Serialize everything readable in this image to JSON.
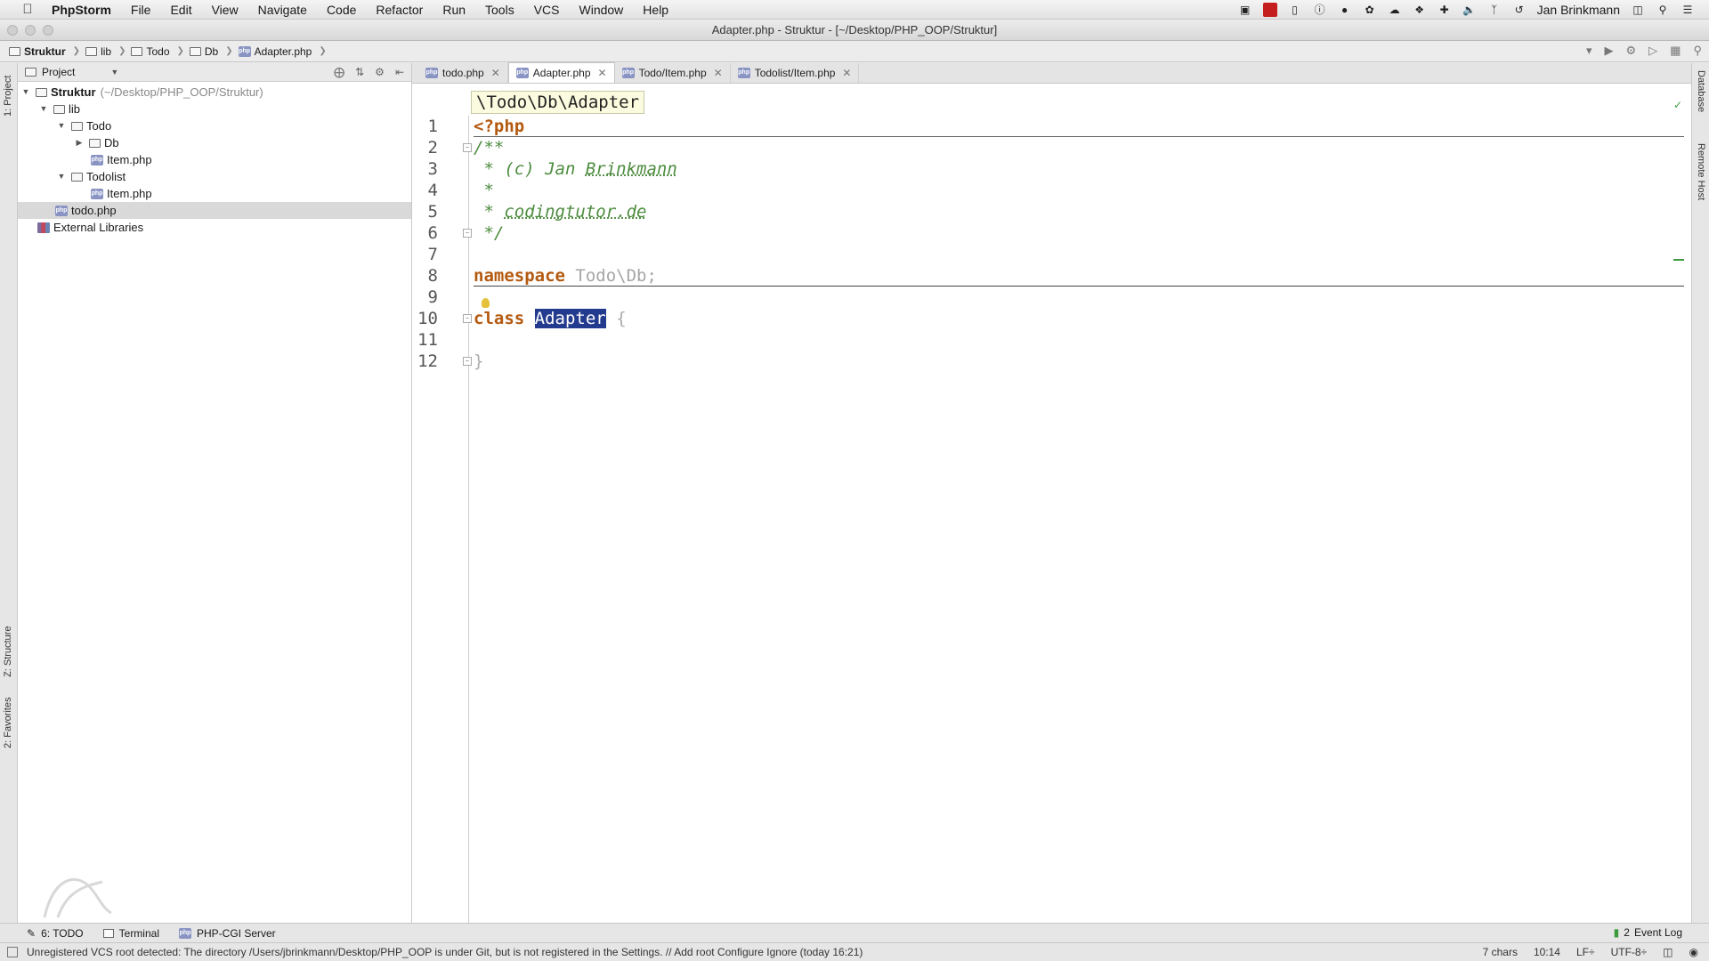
{
  "menubar": {
    "app": "PhpStorm",
    "items": [
      "File",
      "Edit",
      "View",
      "Navigate",
      "Code",
      "Refactor",
      "Run",
      "Tools",
      "VCS",
      "Window",
      "Help"
    ],
    "user": "Jan Brinkmann"
  },
  "window": {
    "title": "Adapter.php - Struktur - [~/Desktop/PHP_OOP/Struktur]"
  },
  "breadcrumb": [
    "Struktur",
    "lib",
    "Todo",
    "Db",
    "Adapter.php"
  ],
  "project_panel": {
    "title": "Project",
    "tree": [
      {
        "label": "Struktur",
        "hint": "(~/Desktop/PHP_OOP/Struktur)"
      },
      {
        "label": "lib"
      },
      {
        "label": "Todo"
      },
      {
        "label": "Db"
      },
      {
        "label": "Item.php"
      },
      {
        "label": "Todolist"
      },
      {
        "label": "Item.php"
      },
      {
        "label": "todo.php"
      },
      {
        "label": "External Libraries"
      }
    ]
  },
  "side_tabs": {
    "left_top": "1: Project",
    "left_mid": "Z: Structure",
    "left_bottom": "2: Favorites",
    "right_top": "Database",
    "right_mid": "Remote Host"
  },
  "tabs": [
    {
      "label": "todo.php"
    },
    {
      "label": "Adapter.php"
    },
    {
      "label": "Todo/Item.php"
    },
    {
      "label": "Todolist/Item.php"
    }
  ],
  "editor": {
    "namespace_badge": "\\Todo\\Db\\Adapter",
    "line_numbers": [
      "1",
      "2",
      "3",
      "4",
      "5",
      "6",
      "7",
      "8",
      "9",
      "10",
      "11",
      "12"
    ],
    "code": {
      "l1": "<?php",
      "l2": "/**",
      "l3a": " * (c) Jan ",
      "l3b": "Brinkmann",
      "l4": " *",
      "l5a": " * ",
      "l5b": "codingtutor.de",
      "l6": " */",
      "l8kw": "namespace",
      "l8ns": "Todo\\Db;",
      "l10kw": "class",
      "l10name": "Adapter",
      "l10brace": "{",
      "l12": "}"
    }
  },
  "tool_windows": [
    "6: TODO",
    "Terminal",
    "PHP-CGI Server"
  ],
  "event_log": "Event Log",
  "event_log_count": "2",
  "status": {
    "message": "Unregistered VCS root detected: The directory /Users/jbrinkmann/Desktop/PHP_OOP is under Git, but is not registered in the Settings. // Add root  Configure  Ignore (today 16:21)",
    "chars": "7 chars",
    "position": "10:14",
    "line_sep": "LF÷",
    "encoding": "UTF-8÷"
  },
  "colors": {
    "keyword": "#b45a10",
    "comment": "#4d8c3f",
    "selection": "#233b8e"
  }
}
